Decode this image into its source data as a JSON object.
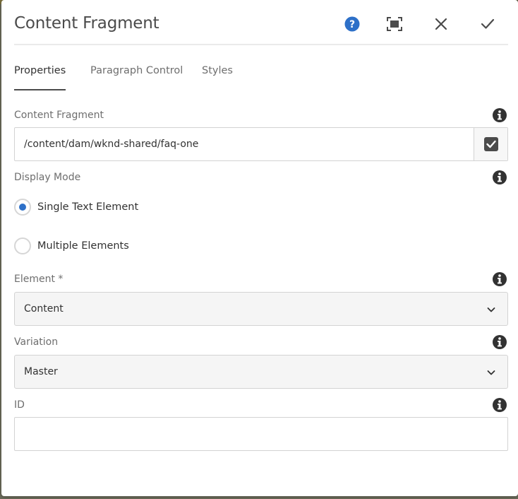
{
  "dialog": {
    "title": "Content Fragment",
    "tabs": [
      {
        "label": "Properties",
        "active": true
      },
      {
        "label": "Paragraph Control",
        "active": false
      },
      {
        "label": "Styles",
        "active": false
      }
    ],
    "header_icons": [
      "help-icon",
      "fullscreen-icon",
      "close-icon",
      "checkmark-icon"
    ]
  },
  "form": {
    "content_fragment": {
      "label": "Content Fragment",
      "value": "/content/dam/wknd-shared/faq-one"
    },
    "display_mode": {
      "label": "Display Mode",
      "options": [
        {
          "label": "Single Text Element",
          "checked": true
        },
        {
          "label": "Multiple Elements",
          "checked": false
        }
      ]
    },
    "element": {
      "label": "Element *",
      "selected": "Content"
    },
    "variation": {
      "label": "Variation",
      "selected": "Master"
    },
    "id": {
      "label": "ID",
      "value": ""
    }
  },
  "colors": {
    "accent": "#2d70c8",
    "help": "#2d70c8",
    "text": "#323232",
    "label": "#6e6e6e",
    "border": "#d3d3d3"
  }
}
